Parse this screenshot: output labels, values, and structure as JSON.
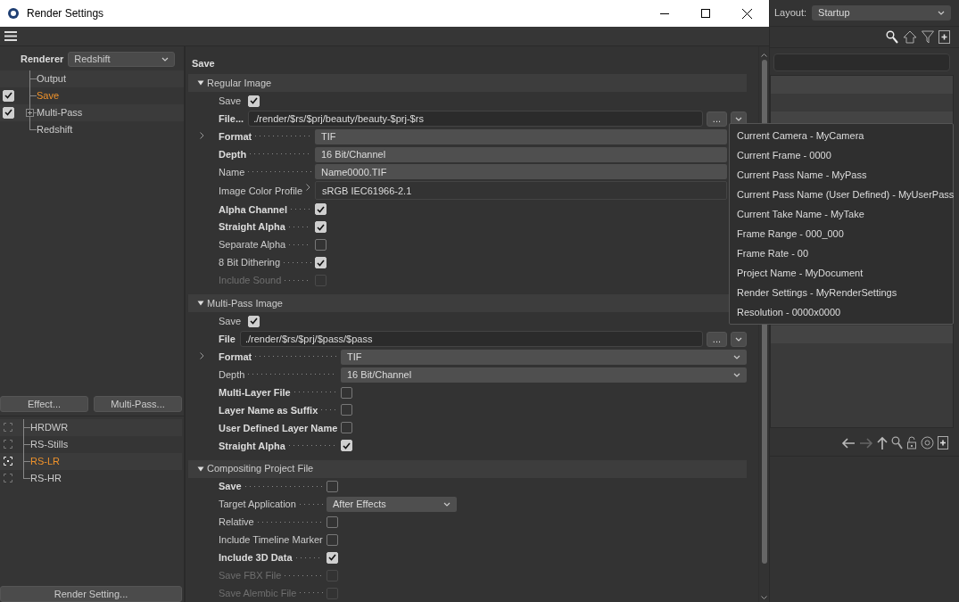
{
  "window": {
    "title": "Render Settings"
  },
  "sidebar": {
    "renderer_label": "Renderer",
    "renderer": "Redshift",
    "tree": [
      {
        "label": "Output",
        "kind": "plain",
        "selected": false
      },
      {
        "label": "Save",
        "kind": "check",
        "checked": true,
        "selected": true
      },
      {
        "label": "Multi-Pass",
        "kind": "check",
        "checked": true,
        "expanded": false,
        "selected": false
      },
      {
        "label": "Redshift",
        "kind": "plain",
        "selected": false
      }
    ],
    "buttons": [
      "Effect...",
      "Multi-Pass..."
    ],
    "render_settings": [
      {
        "label": "HRDWR",
        "selected": false
      },
      {
        "label": "RS-Stills",
        "selected": false
      },
      {
        "label": "RS-LR",
        "selected": true
      },
      {
        "label": "RS-HR",
        "selected": false
      }
    ],
    "bottom_button": "Render Setting..."
  },
  "panel": {
    "title": "Save",
    "groups": [
      {
        "title": "Regular Image",
        "expanded": true,
        "rows": [
          {
            "kind": "inline-check",
            "label": "Save",
            "bold": false,
            "checked": true,
            "disabled": false
          },
          {
            "kind": "file",
            "label": "File...",
            "bold": true,
            "value": "./render/$rs/$prj/beauty/beauty-$prj-$rs",
            "button": "..."
          },
          {
            "kind": "field",
            "label": "Format",
            "bold": true,
            "value": "TIF",
            "expander": true
          },
          {
            "kind": "field",
            "label": "Depth",
            "bold": true,
            "value": "16 Bit/Channel"
          },
          {
            "kind": "field",
            "label": "Name",
            "bold": false,
            "value": "Name0000.TIF"
          },
          {
            "kind": "profile",
            "label": "Image Color Profile",
            "bold": false,
            "value": "sRGB IEC61966-2.1"
          },
          {
            "kind": "check",
            "label": "Alpha Channel",
            "bold": true,
            "checked": true,
            "disabled": false
          },
          {
            "kind": "check",
            "label": "Straight Alpha",
            "bold": true,
            "checked": true,
            "disabled": false
          },
          {
            "kind": "check",
            "label": "Separate Alpha",
            "bold": false,
            "checked": false,
            "disabled": false
          },
          {
            "kind": "check",
            "label": "8 Bit Dithering",
            "bold": false,
            "checked": true,
            "disabled": false
          },
          {
            "kind": "check",
            "label": "Include Sound",
            "bold": false,
            "checked": false,
            "disabled": true
          }
        ]
      },
      {
        "title": "Multi-Pass Image",
        "expanded": true,
        "rows": [
          {
            "kind": "inline-check",
            "label": "Save",
            "bold": false,
            "checked": true,
            "disabled": false
          },
          {
            "kind": "file",
            "label": "File",
            "bold": true,
            "value": "./render/$rs/$prj/$pass/$pass",
            "button": "..."
          },
          {
            "kind": "select",
            "label": "Format",
            "bold": true,
            "value": "TIF",
            "expander": true
          },
          {
            "kind": "select",
            "label": "Depth",
            "bold": false,
            "value": "16 Bit/Channel"
          },
          {
            "kind": "check",
            "label": "Multi-Layer File",
            "bold": true,
            "checked": false,
            "disabled": false
          },
          {
            "kind": "check",
            "label": "Layer Name as Suffix",
            "bold": true,
            "checked": false,
            "disabled": false
          },
          {
            "kind": "check",
            "label": "User Defined Layer Name",
            "bold": true,
            "checked": false,
            "disabled": false
          },
          {
            "kind": "check",
            "label": "Straight Alpha",
            "bold": true,
            "checked": true,
            "disabled": false
          }
        ]
      },
      {
        "title": "Compositing Project File",
        "expanded": true,
        "rows": [
          {
            "kind": "check",
            "label": "Save",
            "bold": true,
            "checked": false,
            "disabled": false
          },
          {
            "kind": "short-select",
            "label": "Target Application",
            "bold": false,
            "value": "After Effects"
          },
          {
            "kind": "check",
            "label": "Relative",
            "bold": false,
            "checked": false,
            "disabled": false
          },
          {
            "kind": "check",
            "label": "Include Timeline Marker",
            "bold": false,
            "checked": false,
            "disabled": false
          },
          {
            "kind": "check",
            "label": "Include 3D Data",
            "bold": true,
            "checked": true,
            "disabled": false
          },
          {
            "kind": "check",
            "label": "Save FBX File",
            "bold": false,
            "checked": false,
            "disabled": true
          },
          {
            "kind": "check",
            "label": "Save Alembic File",
            "bold": false,
            "checked": false,
            "disabled": true
          }
        ]
      }
    ]
  },
  "file_menu": {
    "items": [
      "Current Camera - MyCamera",
      "Current Frame - 0000",
      "Current Pass Name - MyPass",
      "Current Pass Name (User Defined) - MyUserPass",
      "Current Take Name - MyTake",
      "Frame Range - 000_000",
      "Frame Rate - 00",
      "Project Name - MyDocument",
      "Render Settings - MyRenderSettings",
      "Resolution - 0000x0000"
    ]
  },
  "layout": {
    "label": "Layout:",
    "value": "Startup"
  }
}
